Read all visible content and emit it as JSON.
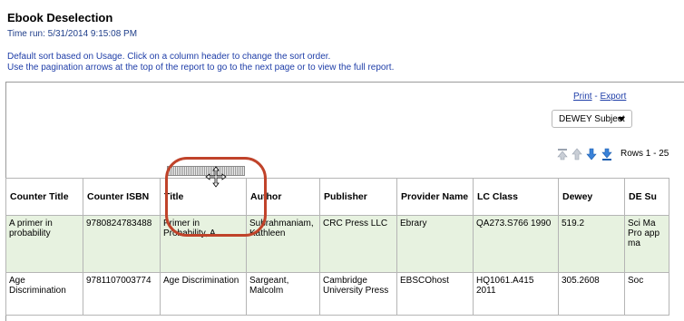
{
  "report": {
    "title": "Ebook Deselection",
    "time_run": "Time run: 5/31/2014 9:15:08 PM",
    "info_line1": "Default sort based on Usage. Click on a column header to change the sort order.",
    "info_line2": "Use the pagination arrows at the top of the report to go to the next page or to view the full report."
  },
  "actions": {
    "print": "Print",
    "separator": " - ",
    "export": "Export"
  },
  "dropdown": {
    "selected": "DEWEY Subject"
  },
  "pager": {
    "rows_label": "Rows 1 - 25"
  },
  "table": {
    "headers": [
      "Counter Title",
      "Counter ISBN",
      "Title",
      "Author",
      "Publisher",
      "Provider Name",
      "LC Class",
      "Dewey",
      "DE Su"
    ],
    "rows": [
      [
        "A primer in probability",
        "9780824783488",
        "Primer in Probability, A",
        "Subrahmaniam, Kathleen",
        "CRC Press LLC",
        "Ebrary",
        "QA273.S766 1990",
        "519.2",
        "Sci Ma Pro app ma"
      ],
      [
        "Age Discrimination",
        "9781107003774",
        "Age Discrimination",
        "Sargeant, Malcolm",
        "Cambridge University Press",
        "EBSCOhost",
        "HQ1061.A415 2011",
        "305.2608",
        "Soc"
      ]
    ]
  },
  "colors": {
    "link": "#1f3ea8",
    "highlight": "#c0432a",
    "row_green": "#e7f2e0"
  },
  "icons": [
    "first-page-icon",
    "previous-page-icon",
    "next-page-icon",
    "last-page-icon",
    "move-cursor-icon"
  ]
}
